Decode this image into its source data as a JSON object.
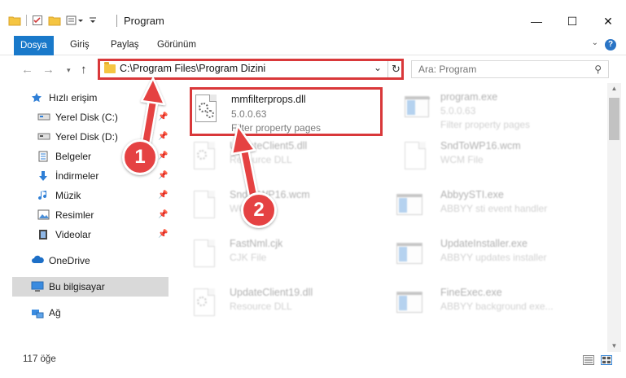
{
  "window": {
    "title": "Program",
    "minimize_glyph": "—",
    "maximize_glyph": "☐",
    "close_glyph": "✕"
  },
  "ribbon": {
    "tabs": [
      {
        "label": "Dosya",
        "active": true
      },
      {
        "label": "Giriş",
        "active": false
      },
      {
        "label": "Paylaş",
        "active": false
      },
      {
        "label": "Görünüm",
        "active": false
      }
    ]
  },
  "address": {
    "path": "C:\\Program Files\\Program Dizini"
  },
  "search": {
    "placeholder": "Ara: Program"
  },
  "sidebar": {
    "items": [
      {
        "label": "Hızlı erişim",
        "icon": "star-icon",
        "pinned": false
      },
      {
        "label": "Yerel Disk (C:)",
        "icon": "drive-icon",
        "pinned": true
      },
      {
        "label": "Yerel Disk (D:)",
        "icon": "drive-icon",
        "pinned": true
      },
      {
        "label": "Belgeler",
        "icon": "documents-icon",
        "pinned": true
      },
      {
        "label": "İndirmeler",
        "icon": "download-icon",
        "pinned": true
      },
      {
        "label": "Müzik",
        "icon": "music-icon",
        "pinned": true
      },
      {
        "label": "Resimler",
        "icon": "pictures-icon",
        "pinned": true
      },
      {
        "label": "Videolar",
        "icon": "video-icon",
        "pinned": true
      },
      {
        "label": "OneDrive",
        "icon": "cloud-icon",
        "pinned": false
      },
      {
        "label": "Bu bilgisayar",
        "icon": "computer-icon",
        "pinned": false,
        "selected": true
      },
      {
        "label": "Ağ",
        "icon": "network-icon",
        "pinned": false
      }
    ]
  },
  "files": [
    {
      "name": "mmfilterprops.dll",
      "version": "5.0.0.63",
      "description": "Filter property pages",
      "icon": "dll-gear-icon",
      "highlighted": true
    },
    {
      "name": "program.exe",
      "version": "5.0.0.63",
      "description": "Filter property pages",
      "icon": "exe-icon",
      "highlighted": false
    },
    {
      "name": "UpdateClient5.dll",
      "version": "",
      "description": "Resource DLL",
      "icon": "dll-gear-icon",
      "highlighted": false
    },
    {
      "name": "SndToWP16.wcm",
      "version": "",
      "description": "WCM File",
      "icon": "file-icon",
      "highlighted": false
    },
    {
      "name": "SndToWP16.wcm",
      "version": "",
      "description": "WCM File",
      "icon": "file-icon",
      "highlighted": false
    },
    {
      "name": "AbbyySTI.exe",
      "version": "",
      "description": "ABBYY sti event handler",
      "icon": "window-app-icon",
      "highlighted": false
    },
    {
      "name": "FastNml.cjk",
      "version": "",
      "description": "CJK File",
      "icon": "file-icon",
      "highlighted": false
    },
    {
      "name": "UpdateInstaller.exe",
      "version": "",
      "description": "ABBYY updates installer",
      "icon": "window-app-icon",
      "highlighted": false
    },
    {
      "name": "UpdateClient19.dll",
      "version": "",
      "description": "Resource DLL",
      "icon": "dll-gear-icon",
      "highlighted": false
    },
    {
      "name": "FineExec.exe",
      "version": "",
      "description": "ABBYY background exe...",
      "icon": "window-app-icon",
      "highlighted": false
    }
  ],
  "status": {
    "count": "117 öğe"
  },
  "callouts": [
    {
      "label": "1"
    },
    {
      "label": "2"
    }
  ],
  "colors": {
    "accent": "#1979ca",
    "highlight": "#d9383a",
    "callout": "#e54243"
  }
}
